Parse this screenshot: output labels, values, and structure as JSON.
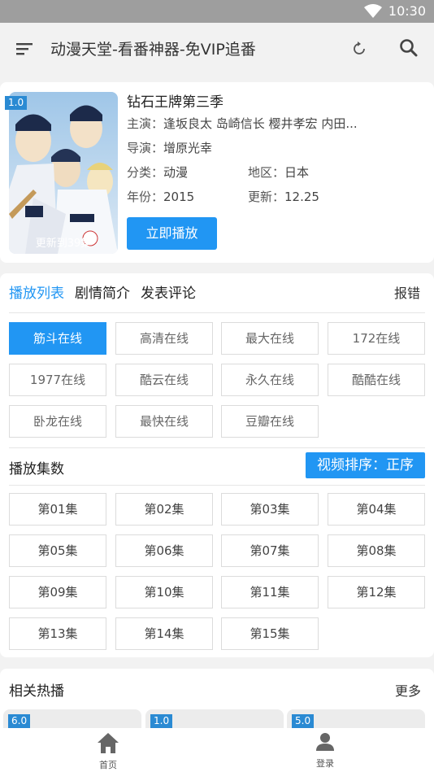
{
  "status_bar": {
    "time": "10:30"
  },
  "app_bar": {
    "title": "动漫天堂-看番神器-免VIP追番"
  },
  "detail": {
    "rating": "1.0",
    "update_badge": "更新到39集",
    "title": "钻石王牌第三季",
    "actors_label": "主演：",
    "actors": "逢坂良太 岛崎信长 樱井孝宏 内田...",
    "director_label": "导演：",
    "director": "增原光幸",
    "category_label": "分类：",
    "category": "动漫",
    "region_label": "地区：",
    "region": "日本",
    "year_label": "年份：",
    "year": "2015",
    "updated_label": "更新：",
    "updated": "12.25",
    "play_button": "立即播放"
  },
  "tabs": [
    "播放列表",
    "剧情简介",
    "发表评论"
  ],
  "report_label": "报错",
  "sources": [
    "筋斗在线",
    "高清在线",
    "最大在线",
    "172在线",
    "1977在线",
    "酷云在线",
    "永久在线",
    "酷酷在线",
    "卧龙在线",
    "最快在线",
    "豆瓣在线"
  ],
  "episodes_section": {
    "label": "播放集数",
    "sort_button": "视频排序：正序",
    "episodes": [
      "第01集",
      "第02集",
      "第03集",
      "第04集",
      "第05集",
      "第06集",
      "第07集",
      "第08集",
      "第09集",
      "第10集",
      "第11集",
      "第12集",
      "第13集",
      "第14集",
      "第15集"
    ]
  },
  "related": {
    "title": "相关热播",
    "more": "更多",
    "ratings": [
      "6.0",
      "1.0",
      "5.0"
    ]
  },
  "bottom_nav": {
    "home": "首页",
    "login": "登录"
  },
  "colors": {
    "accent": "#2196f3",
    "rating_badge": "#2a8ad3",
    "status_bar": "#9e9e9e"
  }
}
